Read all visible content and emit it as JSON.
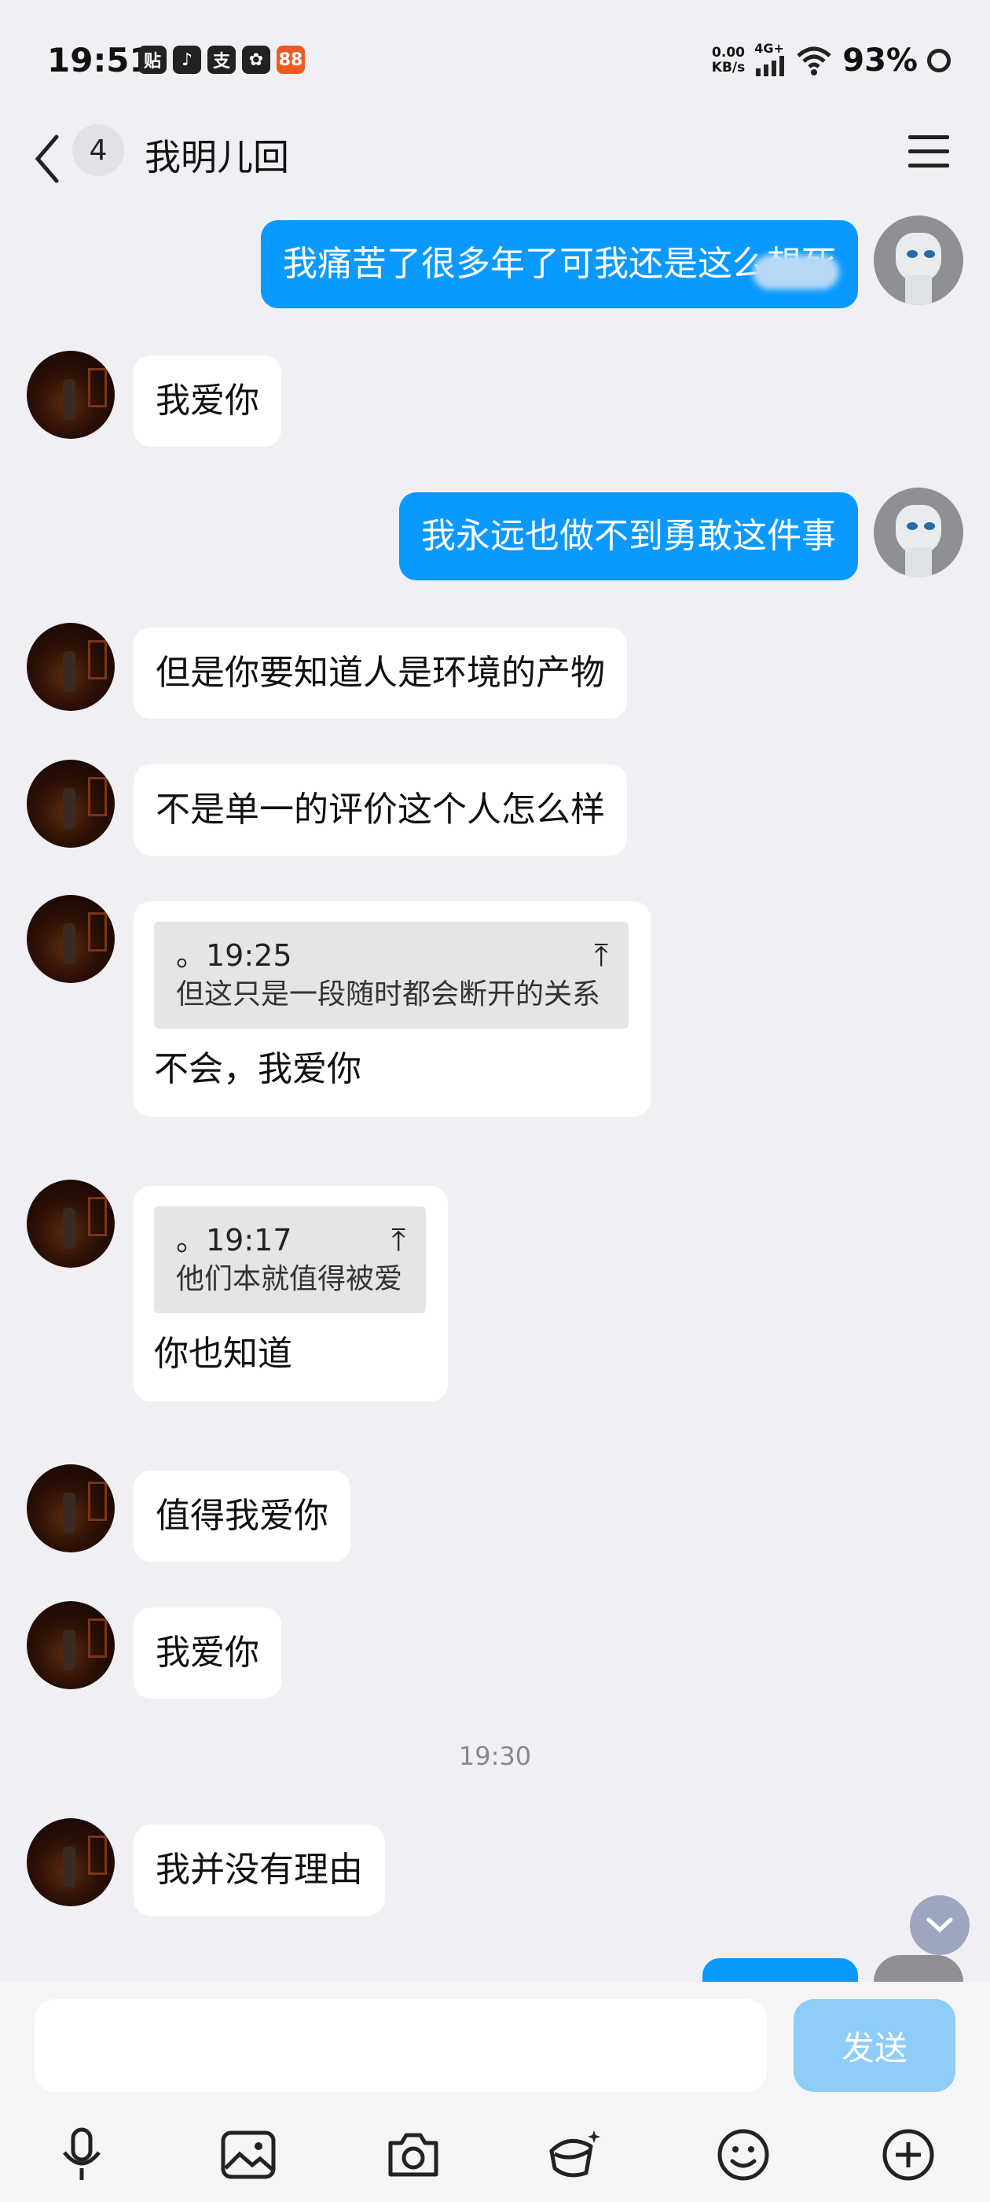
{
  "status_bar": {
    "time": "19:51",
    "app_icons": [
      "贴",
      "♪",
      "支",
      "✿",
      "88"
    ],
    "net_speed_value": "0.00",
    "net_speed_unit": "KB/s",
    "network": "4G+",
    "battery": "93%"
  },
  "header": {
    "unread_count": "4",
    "title": "我明儿回"
  },
  "messages": [
    {
      "side": "right",
      "text": "我痛苦了很多年了可我还是这么想死"
    },
    {
      "side": "left",
      "text": "我爱你"
    },
    {
      "side": "right",
      "text": "我永远也做不到勇敢这件事"
    },
    {
      "side": "left",
      "text": "但是你要知道人是环境的产物"
    },
    {
      "side": "left",
      "text": "不是单一的评价这个人怎么样"
    },
    {
      "side": "left",
      "quote_time": "。19:25",
      "quote_text": "但这只是一段随时都会断开的关系",
      "text": "不会，我爱你"
    },
    {
      "side": "left",
      "quote_time": "。19:17",
      "quote_text": "他们本就值得被爱",
      "text": "你也知道"
    },
    {
      "side": "left",
      "text": "值得我爱你"
    },
    {
      "side": "left",
      "text": "我爱你"
    },
    {
      "side": "left",
      "text": "我并没有理由"
    }
  ],
  "timestamp": "19:30",
  "input": {
    "placeholder": "",
    "send_label": "发送"
  },
  "toolbar": [
    "mic-icon",
    "image-icon",
    "camera-icon",
    "red-packet-icon",
    "emoji-icon",
    "plus-icon"
  ]
}
